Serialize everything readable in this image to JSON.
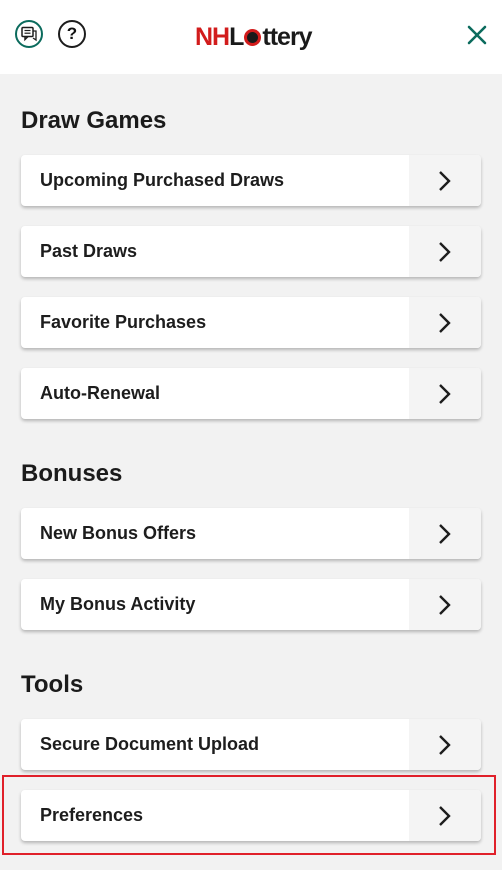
{
  "header": {
    "logo_nh": "NH",
    "logo_rest": "ttery",
    "logo_L": "L",
    "help_label": "?",
    "icons": {
      "chat": "chat-icon",
      "help": "help-icon",
      "close": "close-icon"
    },
    "brand_color": "#d21c1c",
    "accent_color": "#0b6b5d"
  },
  "sections": {
    "draw_games": {
      "title": "Draw Games",
      "items": [
        "Upcoming Purchased Draws",
        "Past Draws",
        "Favorite Purchases",
        "Auto-Renewal"
      ]
    },
    "bonuses": {
      "title": "Bonuses",
      "items": [
        "New Bonus Offers",
        "My Bonus Activity"
      ]
    },
    "tools": {
      "title": "Tools",
      "items": [
        "Secure Document Upload",
        "Preferences"
      ]
    }
  },
  "highlight_color": "#e0202a"
}
